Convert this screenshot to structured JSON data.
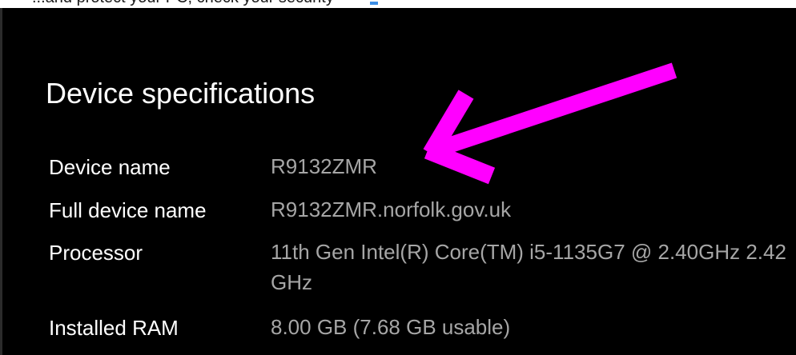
{
  "header": {
    "cut_off_text": "...and protect your PC, check your security"
  },
  "section": {
    "title": "Device specifications"
  },
  "specs": [
    {
      "label": "Device name",
      "value": "R9132ZMR"
    },
    {
      "label": "Full device name",
      "value": "R9132ZMR.norfolk.gov.uk"
    },
    {
      "label": "Processor",
      "value": "11th Gen Intel(R) Core(TM) i5-1135G7 @ 2.40GHz 2.42 GHz"
    },
    {
      "label": "Installed RAM",
      "value": "8.00 GB (7.68 GB usable)"
    }
  ],
  "annotation": {
    "arrow_color": "#ff00ff",
    "arrow_icon": "pointer-arrow-icon"
  }
}
